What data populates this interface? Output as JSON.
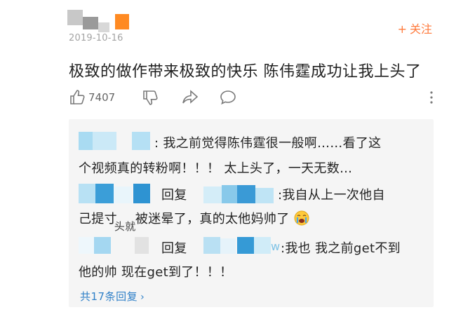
{
  "comment": {
    "date": "2019-10-16",
    "follow_label": "关注",
    "follow_plus": "+",
    "text": "极致的做作带来极致的快乐 陈伟霆成功让我上头了"
  },
  "actions": {
    "like_count": "7407"
  },
  "replies": {
    "reply1_line1": ": 我之前觉得陈伟霆很一般啊……看了这",
    "reply1_line2": "个视频真的转粉啊！！！ 太上头了，一天无数…",
    "reply2_label": "回复",
    "reply2_line1": ":我自从上一次他自",
    "reply2_line2a": "己提寸",
    "reply2_overlay": "头就",
    "reply2_line2b": "被迷晕了，真的太他妈帅了",
    "reply3_label": "回复",
    "reply3_suffix": "w",
    "reply3_line1": ":我也 我之前get不到",
    "reply3_line2": "他的帅 现在get到了！！！",
    "more_label": "共17条回复",
    "more_chevron": "›"
  },
  "colors": {
    "accent_orange": "#ff7a3c",
    "link_blue": "#2f80c8",
    "reply_bg": "#f5f5f5"
  }
}
